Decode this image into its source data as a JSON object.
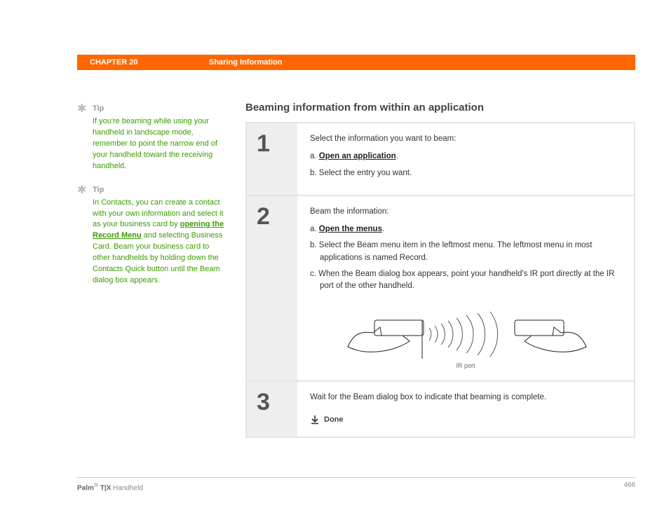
{
  "header": {
    "chapter": "CHAPTER 20",
    "title": "Sharing Information"
  },
  "sidebar": {
    "tips": [
      {
        "label": "Tip",
        "text": "If you're beaming while using your handheld in landscape mode, remember to point the narrow end of your handheld toward the receiving handheld."
      },
      {
        "label": "Tip",
        "text_before": "In Contacts, you can create a contact with your own information and select it as your business card by ",
        "link": "opening the Record Menu",
        "text_after": " and selecting Business Card. Beam your business card to other handhelds by holding down the Contacts Quick button until the Beam dialog box appears."
      }
    ]
  },
  "main": {
    "heading": "Beaming information from within an application",
    "steps": [
      {
        "num": "1",
        "intro": "Select the information you want to beam:",
        "items": [
          {
            "key": "a.",
            "link": "Open an application",
            "after": "."
          },
          {
            "key": "b.",
            "text": "Select the entry you want."
          }
        ]
      },
      {
        "num": "2",
        "intro": "Beam the information:",
        "items": [
          {
            "key": "a.",
            "link": "Open the menus",
            "after": "."
          },
          {
            "key": "b.",
            "text": "Select the Beam menu item in the leftmost menu. The leftmost menu in most applications is named Record."
          },
          {
            "key": "c.",
            "text": "When the Beam dialog box appears, point your handheld's IR port directly at the IR port of the other handheld."
          }
        ],
        "figure_label": "IR port"
      },
      {
        "num": "3",
        "intro": "Wait for the Beam dialog box to indicate that beaming is complete.",
        "done": "Done"
      }
    ]
  },
  "footer": {
    "brand_bold": "Palm",
    "brand_sup": "®",
    "brand_model": " T|X",
    "brand_rest": " Handheld",
    "page": "466"
  }
}
